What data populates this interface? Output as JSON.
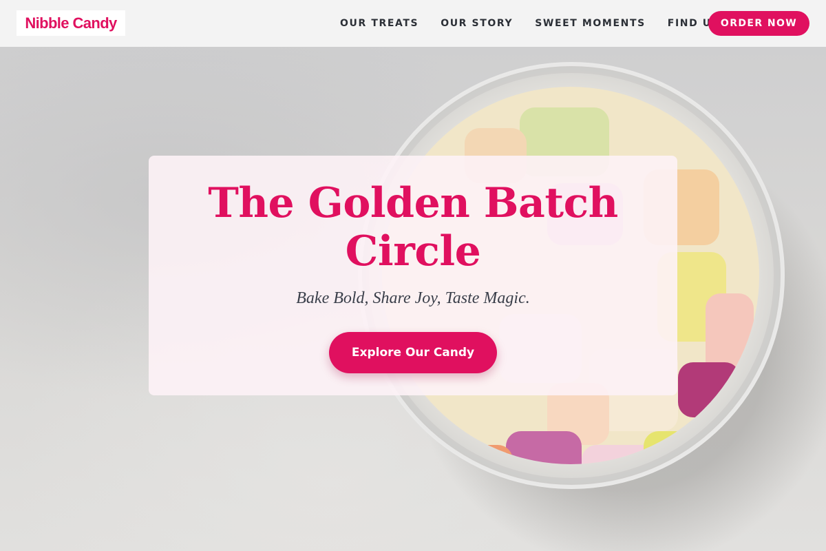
{
  "brand": {
    "name": "Nibble Candy",
    "color": "#e0105f"
  },
  "nav": {
    "items": [
      {
        "label": "OUR TREATS"
      },
      {
        "label": "OUR STORY"
      },
      {
        "label": "SWEET MOMENTS"
      },
      {
        "label": "FIND US"
      }
    ],
    "cta_label": "ORDER NOW"
  },
  "hero": {
    "title": "The Golden Batch Circle",
    "tagline": "Bake Bold, Share Joy, Taste Magic.",
    "button_label": "Explore Our Candy",
    "image": "jar of assorted hard candies"
  },
  "colors": {
    "accent": "#e0105f",
    "header_bg": "#f3f3f3",
    "nav_text": "#2b2f36",
    "card_bg": "#fdf2f6"
  }
}
